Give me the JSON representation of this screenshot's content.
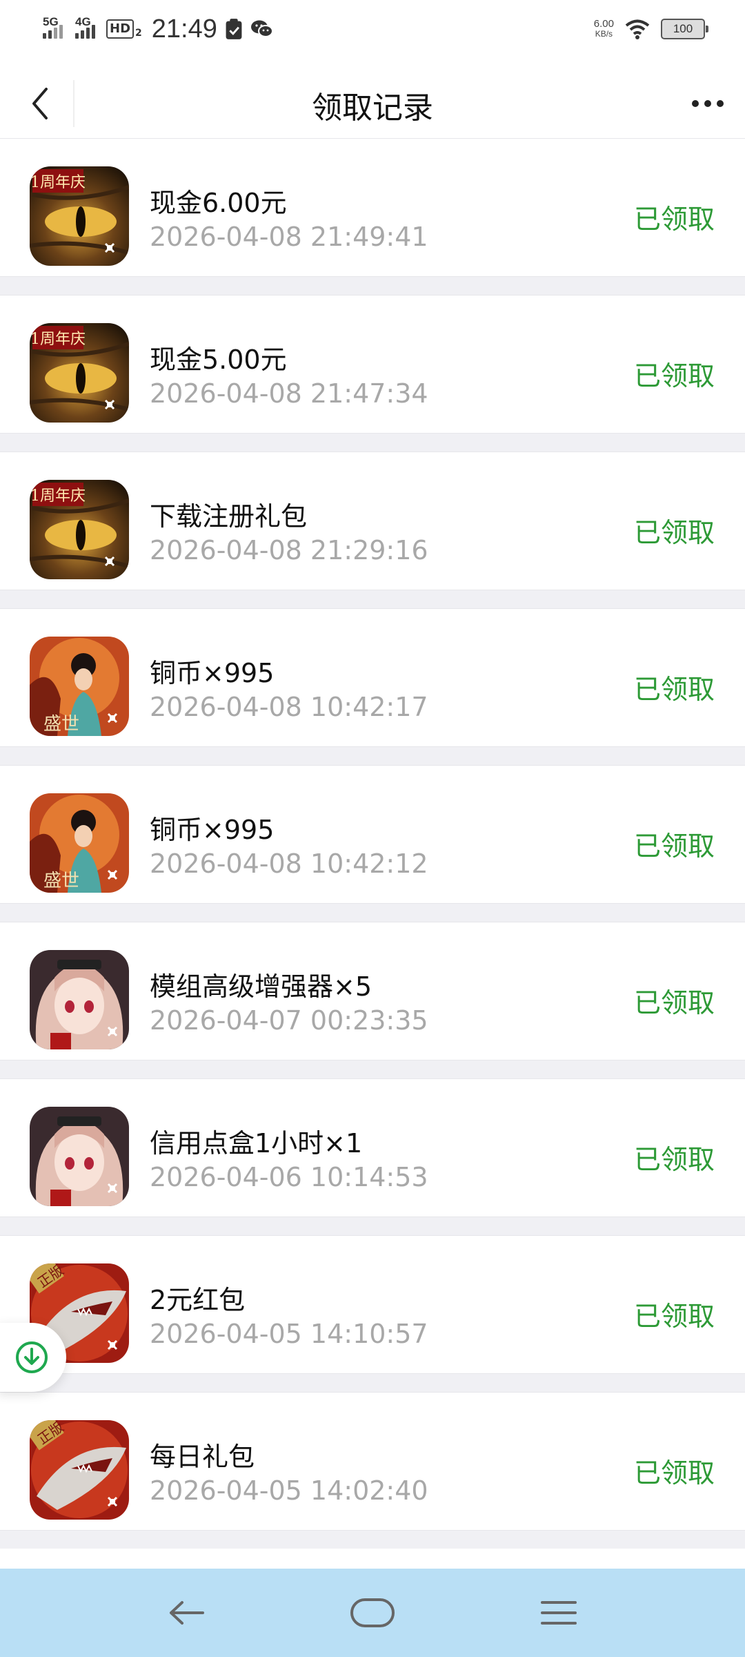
{
  "status_bar": {
    "signal1_label": "5G",
    "signal2_label": "4G",
    "hd_label": "HD",
    "hd_sub": "2",
    "time": "21:49",
    "net_speed_value": "6.00",
    "net_speed_unit": "KB/s",
    "battery": "100"
  },
  "header": {
    "title": "领取记录"
  },
  "records": [
    {
      "title": "现金6.00元",
      "time": "2026-04-08 21:49:41",
      "status": "已领取",
      "icon": "dragon-eye-game-icon",
      "badge": "1周年庆"
    },
    {
      "title": "现金5.00元",
      "time": "2026-04-08 21:47:34",
      "status": "已领取",
      "icon": "dragon-eye-game-icon",
      "badge": "1周年庆"
    },
    {
      "title": "下载注册礼包",
      "time": "2026-04-08 21:29:16",
      "status": "已领取",
      "icon": "dragon-eye-game-icon",
      "badge": "1周年庆"
    },
    {
      "title": "铜币×995",
      "time": "2026-04-08 10:42:17",
      "status": "已领取",
      "icon": "lady-game-icon",
      "badge": "盛世"
    },
    {
      "title": "铜币×995",
      "time": "2026-04-08 10:42:12",
      "status": "已领取",
      "icon": "lady-game-icon",
      "badge": "盛世"
    },
    {
      "title": "模组高级增强器×5",
      "time": "2026-04-07 00:23:35",
      "status": "已领取",
      "icon": "anime-girl-game-icon",
      "badge": ""
    },
    {
      "title": "信用点盒1小时×1",
      "time": "2026-04-06 10:14:53",
      "status": "已领取",
      "icon": "anime-girl-game-icon",
      "badge": ""
    },
    {
      "title": "2元红包",
      "time": "2026-04-05 14:10:57",
      "status": "已领取",
      "icon": "shark-ship-game-icon",
      "badge": "正版"
    },
    {
      "title": "每日礼包",
      "time": "2026-04-05 14:02:40",
      "status": "已领取",
      "icon": "shark-ship-game-icon",
      "badge": "正版"
    }
  ],
  "colors": {
    "status_green": "#2d9a36",
    "time_gray": "#a8a8a8",
    "separator": "#f0f0f4",
    "navbar_bg": "#b9dff5"
  }
}
